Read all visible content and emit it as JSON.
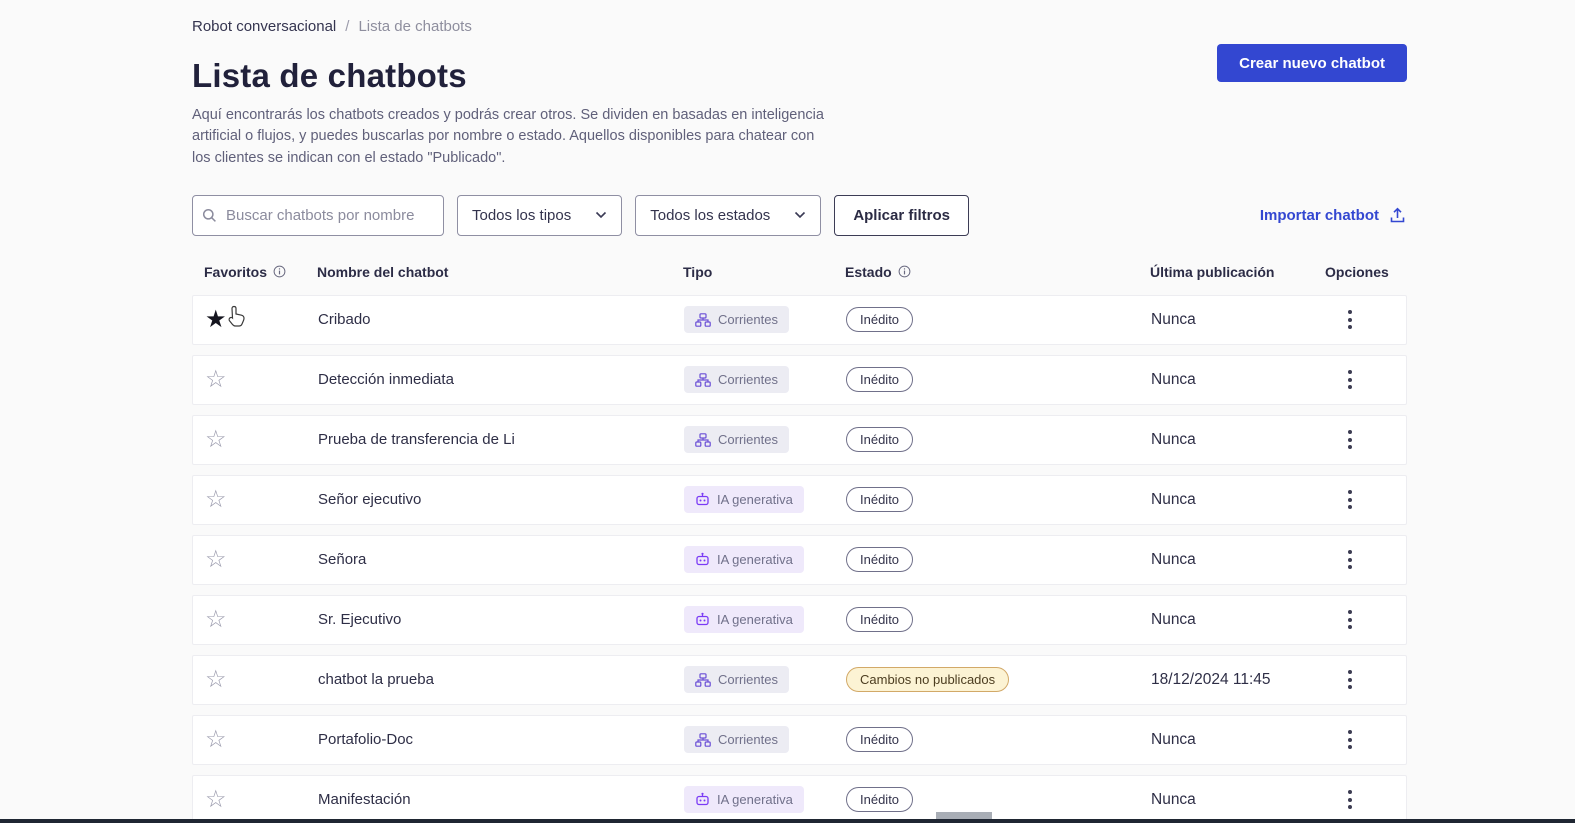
{
  "breadcrumb": {
    "items": [
      "Robot conversacional",
      "Lista de chatbots"
    ],
    "separator": "/"
  },
  "header": {
    "title": "Lista de chatbots",
    "description": "Aquí encontrarás los chatbots creados y podrás crear otros. Se dividen en basadas en inteligencia artificial o flujos, y puedes buscarlas por nombre o estado. Aquellos disponibles para chatear con los clientes se indican con el estado \"Publicado\".",
    "create_button_label": "Crear nuevo chatbot"
  },
  "filters": {
    "search_placeholder": "Buscar chatbots por nombre",
    "type_filter_value": "Todos los tipos",
    "status_filter_value": "Todos los estados",
    "apply_button_label": "Aplicar filtros",
    "import_link_label": "Importar chatbot"
  },
  "table": {
    "columns": [
      "Favoritos",
      "Nombre del chatbot",
      "Tipo",
      "Estado",
      "Última publicación",
      "Opciones"
    ],
    "rows": [
      {
        "favorite": true,
        "name": "Cribado",
        "type_label": "Corrientes",
        "type_kind": "flow",
        "status_label": "Inédito",
        "status_kind": "draft",
        "last_published": "Nunca"
      },
      {
        "favorite": false,
        "name": "Detección inmediata",
        "type_label": "Corrientes",
        "type_kind": "flow",
        "status_label": "Inédito",
        "status_kind": "draft",
        "last_published": "Nunca"
      },
      {
        "favorite": false,
        "name": "Prueba de transferencia de Li",
        "type_label": "Corrientes",
        "type_kind": "flow",
        "status_label": "Inédito",
        "status_kind": "draft",
        "last_published": "Nunca"
      },
      {
        "favorite": false,
        "name": "Señor ejecutivo",
        "type_label": "IA generativa",
        "type_kind": "ai",
        "status_label": "Inédito",
        "status_kind": "draft",
        "last_published": "Nunca"
      },
      {
        "favorite": false,
        "name": "Señora",
        "type_label": "IA generativa",
        "type_kind": "ai",
        "status_label": "Inédito",
        "status_kind": "draft",
        "last_published": "Nunca"
      },
      {
        "favorite": false,
        "name": "Sr. Ejecutivo",
        "type_label": "IA generativa",
        "type_kind": "ai",
        "status_label": "Inédito",
        "status_kind": "draft",
        "last_published": "Nunca"
      },
      {
        "favorite": false,
        "name": "chatbot la prueba",
        "type_label": "Corrientes",
        "type_kind": "flow",
        "status_label": "Cambios no publicados",
        "status_kind": "warning",
        "last_published": "18/12/2024 11:45"
      },
      {
        "favorite": false,
        "name": "Portafolio-Doc",
        "type_label": "Corrientes",
        "type_kind": "flow",
        "status_label": "Inédito",
        "status_kind": "draft",
        "last_published": "Nunca"
      },
      {
        "favorite": false,
        "name": "Manifestación",
        "type_label": "IA generativa",
        "type_kind": "ai",
        "status_label": "Inédito",
        "status_kind": "draft",
        "last_published": "Nunca"
      }
    ]
  },
  "icons": [
    "search-icon",
    "chevron-down-icon",
    "info-icon",
    "upload-icon",
    "flow-icon",
    "robot-icon",
    "star-icon",
    "kebab-menu-icon",
    "mouse-cursor"
  ],
  "colors": {
    "accent_blue": "#3347d1",
    "flow_icon_purple": "#6b4fd6",
    "ai_icon_purple": "#7a3bf5",
    "flow_badge_bg": "#ececf3",
    "ai_badge_bg": "#efe9fb",
    "warning_badge_bg": "#fcf3d4",
    "warning_badge_border": "#d2a968",
    "page_bg": "#fafafa"
  }
}
